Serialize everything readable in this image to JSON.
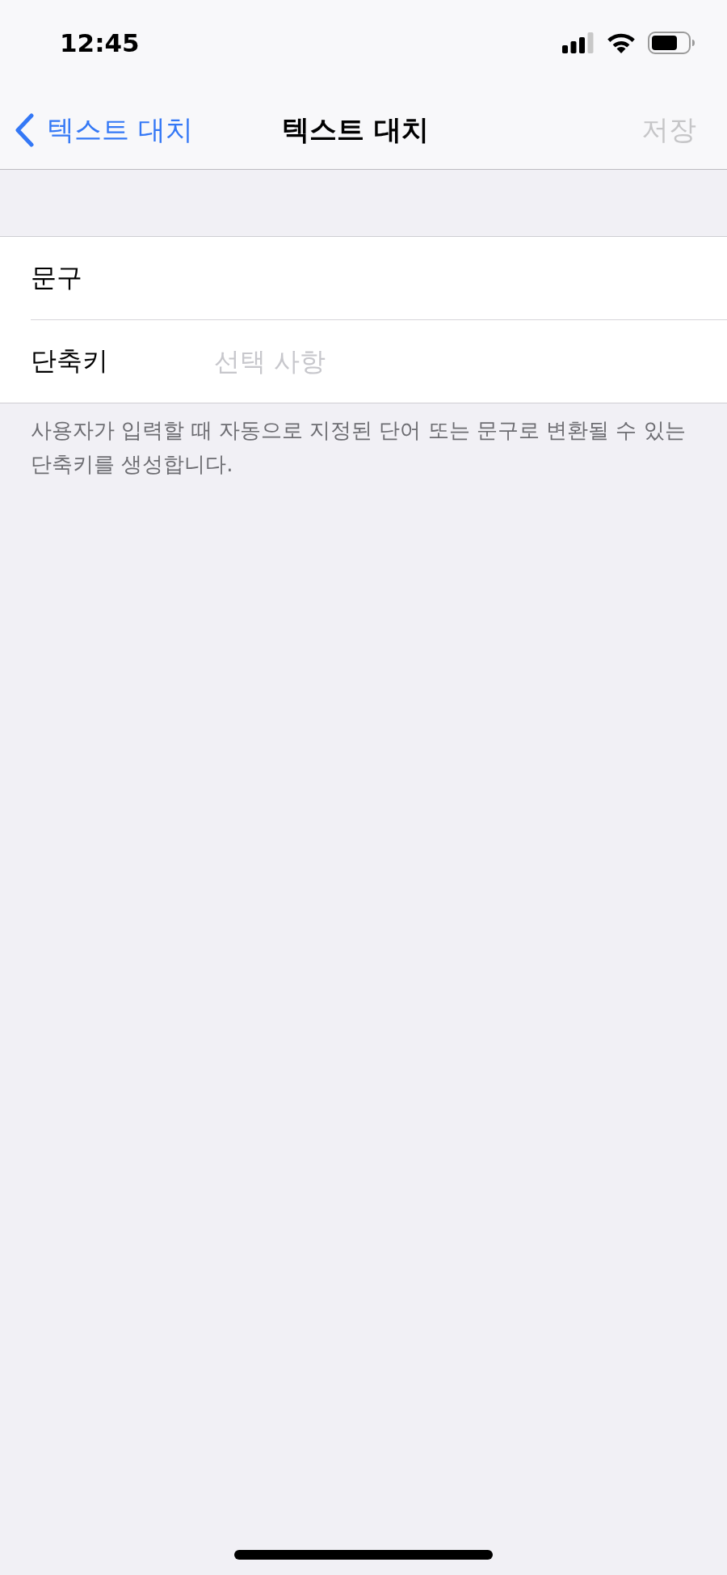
{
  "status_bar": {
    "time": "12:45"
  },
  "nav_bar": {
    "back": {
      "label": "텍스트 대치"
    },
    "title": "텍스트 대치",
    "save": {
      "label": "저장",
      "disabled": true
    }
  },
  "form": {
    "fields": [
      {
        "label": "문구"
      },
      {
        "label": "단축키",
        "placeholder": "선택 사항"
      }
    ],
    "footer": "사용자가 입력할 때 자동으로 지정된 단어 또는 문구로 변환될 수 있는 단축키를 생성합니다."
  }
}
